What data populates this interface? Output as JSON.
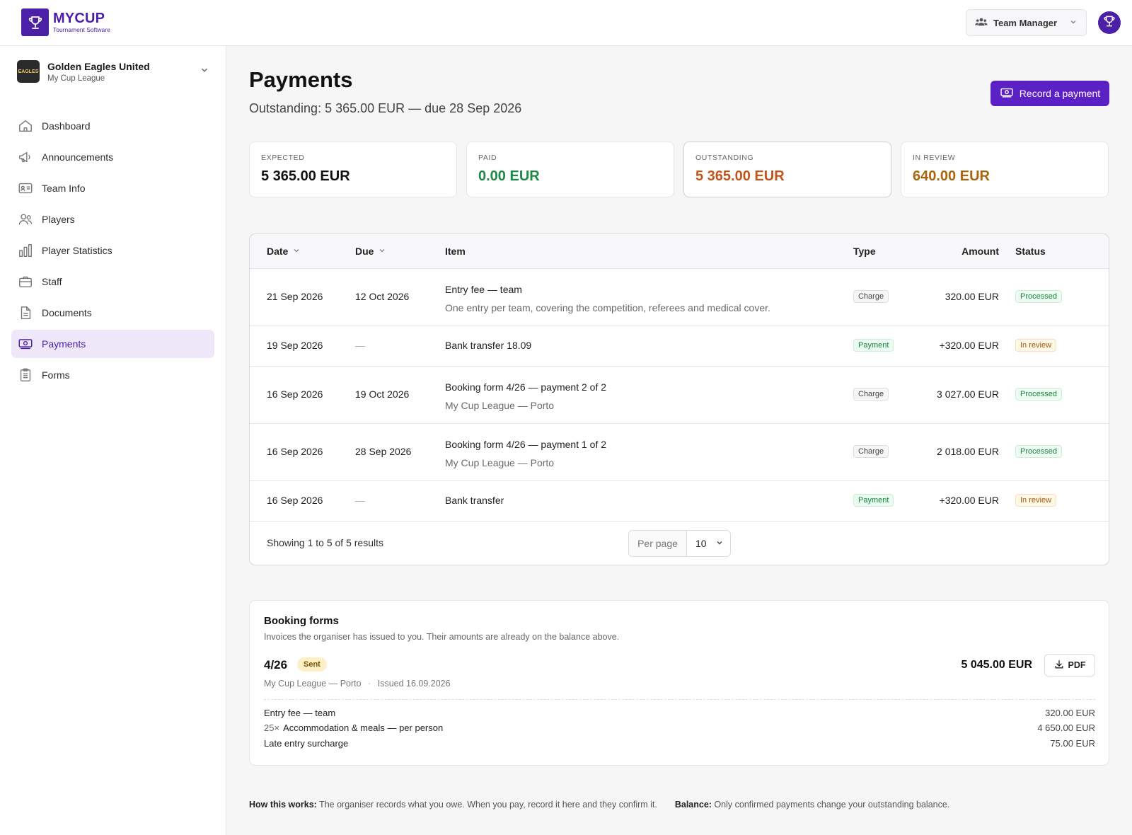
{
  "app": {
    "logo_title": "MYCUP",
    "logo_subtitle": "Tournament Software",
    "role": "Team Manager"
  },
  "team": {
    "name": "Golden Eagles United",
    "league": "My Cup League",
    "logo_text": "EAGLES"
  },
  "nav": [
    {
      "label": "Dashboard",
      "icon": "home-icon"
    },
    {
      "label": "Announcements",
      "icon": "megaphone-icon"
    },
    {
      "label": "Team Info",
      "icon": "id-card-icon"
    },
    {
      "label": "Players",
      "icon": "users-icon"
    },
    {
      "label": "Player Statistics",
      "icon": "bar-chart-icon"
    },
    {
      "label": "Staff",
      "icon": "briefcase-icon"
    },
    {
      "label": "Documents",
      "icon": "document-icon"
    },
    {
      "label": "Payments",
      "icon": "money-icon",
      "active": true
    },
    {
      "label": "Forms",
      "icon": "clipboard-icon"
    }
  ],
  "page": {
    "title": "Payments",
    "subtitle": "Outstanding: 5 365.00 EUR — due 28 Sep 2026",
    "record_button": "Record a payment"
  },
  "summary": [
    {
      "label": "EXPECTED",
      "value": "5 365.00 EUR",
      "color": "#111111"
    },
    {
      "label": "PAID",
      "value": "0.00 EUR",
      "color": "#1b8a45"
    },
    {
      "label": "OUTSTANDING",
      "value": "5 365.00 EUR",
      "color": "#c2561a"
    },
    {
      "label": "IN REVIEW",
      "value": "640.00 EUR",
      "color": "#a8650c"
    }
  ],
  "table": {
    "headers": {
      "date": "Date",
      "due": "Due",
      "item": "Item",
      "type": "Type",
      "amount": "Amount",
      "status": "Status"
    },
    "rows": [
      {
        "date": "21 Sep 2026",
        "due": "12 Oct 2026",
        "item": "Entry fee — team",
        "desc": "One entry per team, covering the competition, referees and medical cover.",
        "type": "Charge",
        "amount": "320.00 EUR",
        "status": "Processed"
      },
      {
        "date": "19 Sep 2026",
        "due": "—",
        "item": "Bank transfer 18.09",
        "desc": "",
        "type": "Payment",
        "amount": "+320.00 EUR",
        "status": "In review"
      },
      {
        "date": "16 Sep 2026",
        "due": "19 Oct 2026",
        "item": "Booking form 4/26 — payment 2 of 2",
        "desc": "My Cup League — Porto",
        "type": "Charge",
        "amount": "3 027.00 EUR",
        "status": "Processed"
      },
      {
        "date": "16 Sep 2026",
        "due": "28 Sep 2026",
        "item": "Booking form 4/26 — payment 1 of 2",
        "desc": "My Cup League — Porto",
        "type": "Charge",
        "amount": "2 018.00 EUR",
        "status": "Processed"
      },
      {
        "date": "16 Sep 2026",
        "due": "—",
        "item": "Bank transfer",
        "desc": "",
        "type": "Payment",
        "amount": "+320.00 EUR",
        "status": "In review"
      }
    ],
    "showing": "Showing 1 to 5 of 5 results",
    "per_page_label": "Per page",
    "per_page_value": "10"
  },
  "booking_forms": {
    "title": "Booking forms",
    "description": "Invoices the organiser has issued to you. Their amounts are already on the balance above.",
    "form": {
      "number": "4/26",
      "status": "Sent",
      "venue": "My Cup League — Porto",
      "separator": "·",
      "issued": "Issued 16.09.2026",
      "total": "5 045.00 EUR",
      "pdf_label": "PDF",
      "lines": [
        {
          "qty": "",
          "label": "Entry fee — team",
          "amount": "320.00 EUR"
        },
        {
          "qty": "25×",
          "label": "Accommodation & meals — per person",
          "amount": "4 650.00 EUR"
        },
        {
          "qty": "",
          "label": "Late entry surcharge",
          "amount": "75.00 EUR"
        }
      ]
    }
  },
  "footer": {
    "how_label": "How this works:",
    "how_text": "The organiser records what you owe. When you pay, record it here and they confirm it.",
    "balance_label": "Balance:",
    "balance_text": "Only confirmed payments change your outstanding balance."
  }
}
